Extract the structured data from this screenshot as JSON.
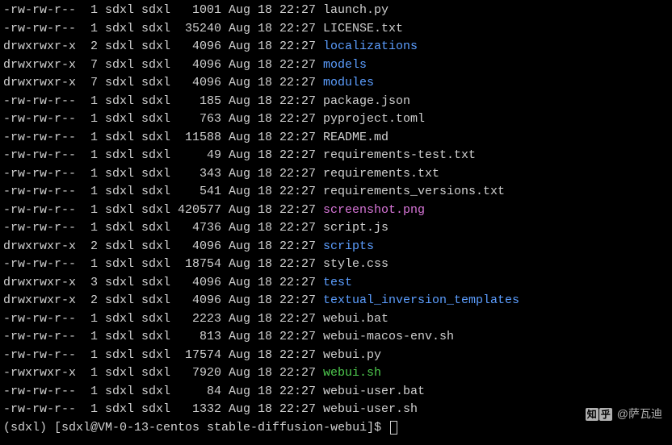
{
  "colors": {
    "file": "#d0d0d0",
    "dir": "#5c9eff",
    "exec": "#4ec94e",
    "img": "#d976d9"
  },
  "rows": [
    {
      "perms": "-rw-rw-r--",
      "links": "1",
      "owner": "sdxl",
      "group": "sdxl",
      "size": "1001",
      "month": "Aug",
      "day": "18",
      "time": "22:27",
      "name": "launch.py",
      "type": "file"
    },
    {
      "perms": "-rw-rw-r--",
      "links": "1",
      "owner": "sdxl",
      "group": "sdxl",
      "size": "35240",
      "month": "Aug",
      "day": "18",
      "time": "22:27",
      "name": "LICENSE.txt",
      "type": "file"
    },
    {
      "perms": "drwxrwxr-x",
      "links": "2",
      "owner": "sdxl",
      "group": "sdxl",
      "size": "4096",
      "month": "Aug",
      "day": "18",
      "time": "22:27",
      "name": "localizations",
      "type": "dir"
    },
    {
      "perms": "drwxrwxr-x",
      "links": "7",
      "owner": "sdxl",
      "group": "sdxl",
      "size": "4096",
      "month": "Aug",
      "day": "18",
      "time": "22:27",
      "name": "models",
      "type": "dir"
    },
    {
      "perms": "drwxrwxr-x",
      "links": "7",
      "owner": "sdxl",
      "group": "sdxl",
      "size": "4096",
      "month": "Aug",
      "day": "18",
      "time": "22:27",
      "name": "modules",
      "type": "dir"
    },
    {
      "perms": "-rw-rw-r--",
      "links": "1",
      "owner": "sdxl",
      "group": "sdxl",
      "size": "185",
      "month": "Aug",
      "day": "18",
      "time": "22:27",
      "name": "package.json",
      "type": "file"
    },
    {
      "perms": "-rw-rw-r--",
      "links": "1",
      "owner": "sdxl",
      "group": "sdxl",
      "size": "763",
      "month": "Aug",
      "day": "18",
      "time": "22:27",
      "name": "pyproject.toml",
      "type": "file"
    },
    {
      "perms": "-rw-rw-r--",
      "links": "1",
      "owner": "sdxl",
      "group": "sdxl",
      "size": "11588",
      "month": "Aug",
      "day": "18",
      "time": "22:27",
      "name": "README.md",
      "type": "file"
    },
    {
      "perms": "-rw-rw-r--",
      "links": "1",
      "owner": "sdxl",
      "group": "sdxl",
      "size": "49",
      "month": "Aug",
      "day": "18",
      "time": "22:27",
      "name": "requirements-test.txt",
      "type": "file"
    },
    {
      "perms": "-rw-rw-r--",
      "links": "1",
      "owner": "sdxl",
      "group": "sdxl",
      "size": "343",
      "month": "Aug",
      "day": "18",
      "time": "22:27",
      "name": "requirements.txt",
      "type": "file"
    },
    {
      "perms": "-rw-rw-r--",
      "links": "1",
      "owner": "sdxl",
      "group": "sdxl",
      "size": "541",
      "month": "Aug",
      "day": "18",
      "time": "22:27",
      "name": "requirements_versions.txt",
      "type": "file"
    },
    {
      "perms": "-rw-rw-r--",
      "links": "1",
      "owner": "sdxl",
      "group": "sdxl",
      "size": "420577",
      "month": "Aug",
      "day": "18",
      "time": "22:27",
      "name": "screenshot.png",
      "type": "img"
    },
    {
      "perms": "-rw-rw-r--",
      "links": "1",
      "owner": "sdxl",
      "group": "sdxl",
      "size": "4736",
      "month": "Aug",
      "day": "18",
      "time": "22:27",
      "name": "script.js",
      "type": "file"
    },
    {
      "perms": "drwxrwxr-x",
      "links": "2",
      "owner": "sdxl",
      "group": "sdxl",
      "size": "4096",
      "month": "Aug",
      "day": "18",
      "time": "22:27",
      "name": "scripts",
      "type": "dir"
    },
    {
      "perms": "-rw-rw-r--",
      "links": "1",
      "owner": "sdxl",
      "group": "sdxl",
      "size": "18754",
      "month": "Aug",
      "day": "18",
      "time": "22:27",
      "name": "style.css",
      "type": "file"
    },
    {
      "perms": "drwxrwxr-x",
      "links": "3",
      "owner": "sdxl",
      "group": "sdxl",
      "size": "4096",
      "month": "Aug",
      "day": "18",
      "time": "22:27",
      "name": "test",
      "type": "dir"
    },
    {
      "perms": "drwxrwxr-x",
      "links": "2",
      "owner": "sdxl",
      "group": "sdxl",
      "size": "4096",
      "month": "Aug",
      "day": "18",
      "time": "22:27",
      "name": "textual_inversion_templates",
      "type": "dir"
    },
    {
      "perms": "-rw-rw-r--",
      "links": "1",
      "owner": "sdxl",
      "group": "sdxl",
      "size": "2223",
      "month": "Aug",
      "day": "18",
      "time": "22:27",
      "name": "webui.bat",
      "type": "file"
    },
    {
      "perms": "-rw-rw-r--",
      "links": "1",
      "owner": "sdxl",
      "group": "sdxl",
      "size": "813",
      "month": "Aug",
      "day": "18",
      "time": "22:27",
      "name": "webui-macos-env.sh",
      "type": "file"
    },
    {
      "perms": "-rw-rw-r--",
      "links": "1",
      "owner": "sdxl",
      "group": "sdxl",
      "size": "17574",
      "month": "Aug",
      "day": "18",
      "time": "22:27",
      "name": "webui.py",
      "type": "file"
    },
    {
      "perms": "-rwxrwxr-x",
      "links": "1",
      "owner": "sdxl",
      "group": "sdxl",
      "size": "7920",
      "month": "Aug",
      "day": "18",
      "time": "22:27",
      "name": "webui.sh",
      "type": "exec"
    },
    {
      "perms": "-rw-rw-r--",
      "links": "1",
      "owner": "sdxl",
      "group": "sdxl",
      "size": "84",
      "month": "Aug",
      "day": "18",
      "time": "22:27",
      "name": "webui-user.bat",
      "type": "file"
    },
    {
      "perms": "-rw-rw-r--",
      "links": "1",
      "owner": "sdxl",
      "group": "sdxl",
      "size": "1332",
      "month": "Aug",
      "day": "18",
      "time": "22:27",
      "name": "webui-user.sh",
      "type": "file"
    }
  ],
  "prompt": "(sdxl) [sdxl@VM-0-13-centos stable-diffusion-webui]$ ",
  "watermark": {
    "logo_chars": [
      "知",
      "乎"
    ],
    "text": "@萨瓦迪"
  }
}
